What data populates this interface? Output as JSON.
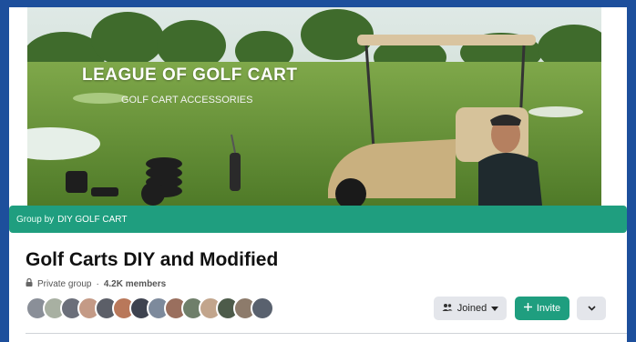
{
  "cover": {
    "title": "LEAGUE OF GOLF CART",
    "subtitle": "GOLF CART ACCESSORIES"
  },
  "group_by": {
    "prefix": "Group by",
    "name": "DIY GOLF CART"
  },
  "group": {
    "name": "Golf Carts DIY and Modified",
    "privacy_icon": "lock-icon",
    "privacy": "Private group",
    "separator": "·",
    "members": "4.2K members"
  },
  "actions": {
    "joined_label": "Joined",
    "joined_icon": "members-icon",
    "invite_label": "Invite",
    "invite_icon": "plus-icon",
    "more_icon": "chevron-down-icon"
  },
  "colors": {
    "accent": "#1f9e7f",
    "background": "#1d4f9c"
  },
  "member_avatars": [
    "#8a8f98",
    "#a8b0a2",
    "#6b6f7a",
    "#c49a86",
    "#5c5f68",
    "#b9785a",
    "#3e4350",
    "#7d8a9c",
    "#9a6f5e",
    "#6f7f6a",
    "#c2a58c",
    "#4d5b4a",
    "#8d7b6b",
    "#59616e"
  ]
}
